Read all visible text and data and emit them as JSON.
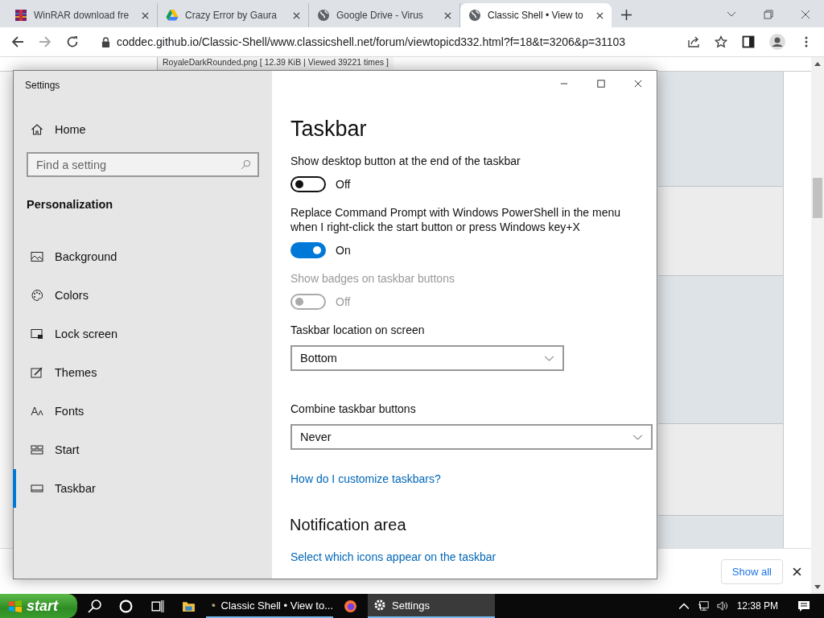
{
  "browser": {
    "tabs": [
      {
        "title": "WinRAR download fre",
        "selected": false
      },
      {
        "title": "Crazy Error by Gaura",
        "selected": false
      },
      {
        "title": "Google Drive - Virus",
        "selected": false
      },
      {
        "title": "Classic Shell • View to",
        "selected": true
      }
    ],
    "address": "coddec.github.io/Classic-Shell/www.classicshell.net/forum/viewtopicd332.html?f=18&t=3206&p=31103"
  },
  "page": {
    "attachment_caption": "RoyaleDarkRounded.png [ 12.39 KiB | Viewed 39221 times ]"
  },
  "download_bar": {
    "button": "Show all"
  },
  "settings": {
    "title": "Settings",
    "home": "Home",
    "search": {
      "placeholder": "Find a setting"
    },
    "section": "Personalization",
    "nav": [
      {
        "label": "Background",
        "selected": false
      },
      {
        "label": "Colors",
        "selected": false
      },
      {
        "label": "Lock screen",
        "selected": false
      },
      {
        "label": "Themes",
        "selected": false
      },
      {
        "label": "Fonts",
        "selected": false
      },
      {
        "label": "Start",
        "selected": false
      },
      {
        "label": "Taskbar",
        "selected": true
      }
    ],
    "heading": "Taskbar",
    "options": [
      {
        "kind": "toggle",
        "label": "Show desktop button at the end of the taskbar",
        "on": false,
        "disabled": false,
        "state": "Off"
      },
      {
        "kind": "toggle",
        "label": "Replace Command Prompt with Windows PowerShell in the menu when I right-click the start button or press Windows key+X",
        "on": true,
        "disabled": false,
        "state": "On"
      },
      {
        "kind": "toggle",
        "label": "Show badges on taskbar buttons",
        "on": false,
        "disabled": true,
        "state": "Off"
      },
      {
        "kind": "dropdown",
        "label": "Taskbar location on screen",
        "value": "Bottom"
      },
      {
        "kind": "dropdown",
        "label": "Combine taskbar buttons",
        "value": "Never"
      }
    ],
    "help_link": "How do I customize taskbars?",
    "subheading": "Notification area",
    "sub_link": "Select which icons appear on the taskbar"
  },
  "taskbar": {
    "start": "start",
    "apps": [
      {
        "label": "Classic Shell • View to...",
        "selected": false
      },
      {
        "label": "Settings",
        "selected": true
      }
    ],
    "clock": "12:38 PM"
  }
}
